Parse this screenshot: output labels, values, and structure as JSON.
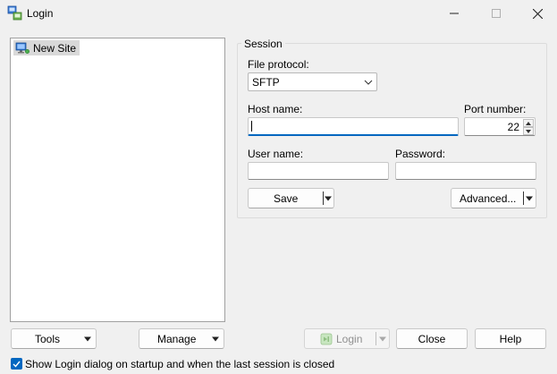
{
  "window": {
    "title": "Login",
    "icon": "winscp-login-icon"
  },
  "sites": {
    "items": [
      {
        "label": "New Site",
        "icon": "monitor-network-icon",
        "selected": true
      }
    ]
  },
  "session": {
    "legend": "Session",
    "file_protocol_label": "File protocol:",
    "file_protocol_value": "SFTP",
    "host_name_label": "Host name:",
    "host_name_value": "",
    "port_number_label": "Port number:",
    "port_number_value": "22",
    "user_name_label": "User name:",
    "user_name_value": "",
    "password_label": "Password:",
    "password_value": "",
    "save_label": "Save",
    "advanced_label": "Advanced..."
  },
  "bottom": {
    "tools_label": "Tools",
    "manage_label": "Manage",
    "login_label": "Login",
    "close_label": "Close",
    "help_label": "Help",
    "show_dialog_label": "Show Login dialog on startup and when the last session is closed",
    "show_dialog_checked": true
  },
  "colors": {
    "accent": "#0067c0",
    "background": "#f0f0f0"
  }
}
